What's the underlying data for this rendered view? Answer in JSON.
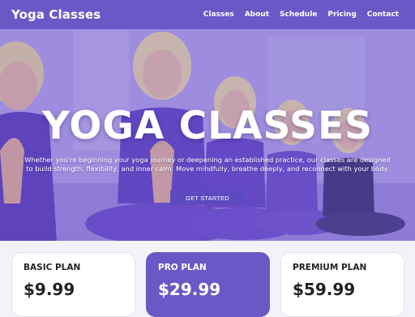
{
  "navbar": {
    "brand": "Yoga Classes",
    "links": [
      "Classes",
      "About",
      "Schedule",
      "Pricing",
      "Contact"
    ]
  },
  "hero": {
    "title": "YOGA CLASSES",
    "text": "Whether you're beginning your yoga journey or deepening an established practice, our classes are designed to build strength, flexibility, and inner calm. Move mindfully, breathe deeply, and reconnect with your body.",
    "cta_label": "GET STARTED"
  },
  "pricing": {
    "plans": [
      {
        "name": "BASIC PLAN",
        "price": "$9.99",
        "featured": false
      },
      {
        "name": "PRO PLAN",
        "price": "$29.99",
        "featured": true
      },
      {
        "name": "PREMIUM PLAN",
        "price": "$59.99",
        "featured": false
      }
    ]
  },
  "colors": {
    "accent": "#6a58c6",
    "button": "#5d49c0",
    "card_bg": "#ffffff",
    "page_bg": "#f3f2f8"
  }
}
